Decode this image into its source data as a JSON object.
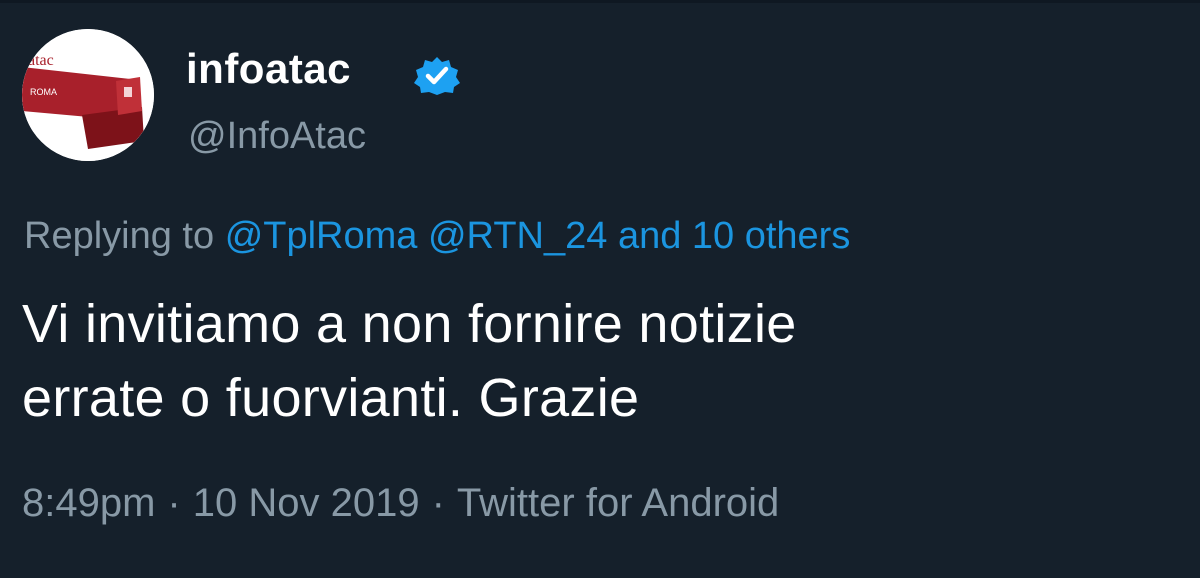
{
  "tweet": {
    "avatar_text_top": "atac",
    "avatar_text_sign": "ROMA",
    "display_name": "infoatac",
    "handle": "@InfoAtac",
    "replying_prefix": "Replying to",
    "replying_to": [
      "@TplRoma",
      "@RTN_24"
    ],
    "replying_others": "and 10 others",
    "body_line1": "Vi invitiamo a non fornire notizie",
    "body_line2": "errate o fuorvianti. Grazie",
    "time": "8:49pm",
    "separator": "·",
    "date": "10 Nov 2019",
    "source": "Twitter for Android",
    "colors": {
      "background": "#15202b",
      "secondary_text": "#8899a6",
      "link": "#1b95e0",
      "verified": "#1da1f2",
      "brand_red": "#a8202b"
    }
  }
}
